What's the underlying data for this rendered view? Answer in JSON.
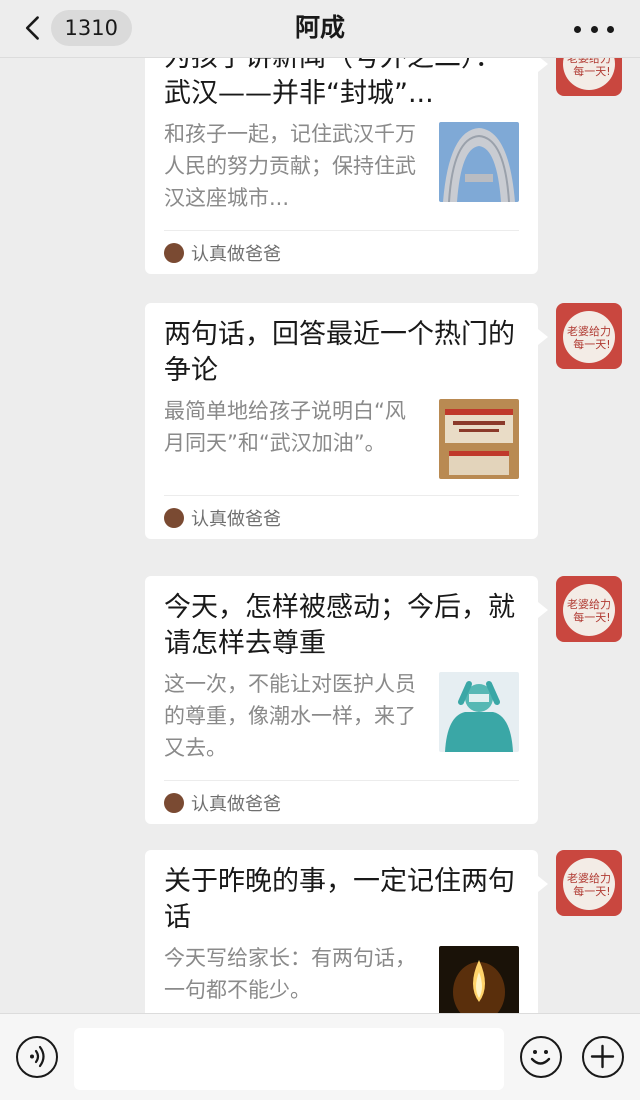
{
  "header": {
    "unread_count": "1310",
    "title": "阿成"
  },
  "articles": [
    {
      "title": "为孩子讲新闻（号外之二）：武汉——并非“封城”...",
      "description": "和孩子一起，记住武汉千万人民的努力贡献；保持住武汉这座城市...",
      "thumbnail": "wuhan-building-image",
      "source": "认真做爸爸"
    },
    {
      "title": "两句话，回答最近一个热门的争论",
      "description": "最简单地给孩子说明白“风月同天”和“武汉加油”。",
      "thumbnail": "supply-boxes-image",
      "source": "认真做爸爸"
    },
    {
      "title": "今天，怎样被感动；今后，就请怎样去尊重",
      "description": "这一次，不能让对医护人员的尊重，像潮水一样，来了又去。",
      "thumbnail": "medical-worker-image",
      "source": "认真做爸爸"
    },
    {
      "title": "关于昨晚的事，一定记住两句话",
      "description": "今天写给家长：有两句话，一句都不能少。",
      "thumbnail": "candle-image",
      "source": ""
    }
  ],
  "sender_avatar": {
    "text": "老婆给力每一天!",
    "color": "#c9473f"
  },
  "input_bar": {
    "icons": [
      "voice-icon",
      "emoji-icon",
      "plus-icon"
    ]
  }
}
